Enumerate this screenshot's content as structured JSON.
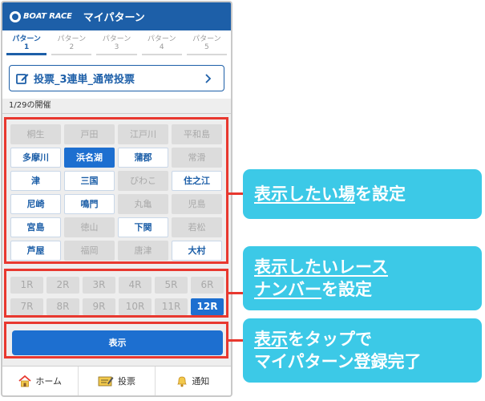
{
  "app": {
    "logo_text": "BOAT RACE",
    "title": "マイパターン"
  },
  "tabs": [
    {
      "label": "パターン",
      "num": "1",
      "active": true
    },
    {
      "label": "パターン",
      "num": "2",
      "active": false
    },
    {
      "label": "パターン",
      "num": "3",
      "active": false
    },
    {
      "label": "パターン",
      "num": "4",
      "active": false
    },
    {
      "label": "パターン",
      "num": "5",
      "active": false
    }
  ],
  "vote_button": {
    "label": "投票_3連単_通常投票"
  },
  "date_label": "1/29の開催",
  "venues": [
    {
      "name": "桐生",
      "state": "off"
    },
    {
      "name": "戸田",
      "state": "off"
    },
    {
      "name": "江戸川",
      "state": "off"
    },
    {
      "name": "平和島",
      "state": "off"
    },
    {
      "name": "多摩川",
      "state": "on"
    },
    {
      "name": "浜名湖",
      "state": "sel"
    },
    {
      "name": "蒲郡",
      "state": "on"
    },
    {
      "name": "常滑",
      "state": "off"
    },
    {
      "name": "津",
      "state": "on"
    },
    {
      "name": "三国",
      "state": "on"
    },
    {
      "name": "びわこ",
      "state": "off"
    },
    {
      "name": "住之江",
      "state": "on"
    },
    {
      "name": "尼崎",
      "state": "on"
    },
    {
      "name": "鳴門",
      "state": "on"
    },
    {
      "name": "丸亀",
      "state": "off"
    },
    {
      "name": "児島",
      "state": "off"
    },
    {
      "name": "宮島",
      "state": "on"
    },
    {
      "name": "徳山",
      "state": "off"
    },
    {
      "name": "下関",
      "state": "on"
    },
    {
      "name": "若松",
      "state": "off"
    },
    {
      "name": "芦屋",
      "state": "on"
    },
    {
      "name": "福岡",
      "state": "off"
    },
    {
      "name": "唐津",
      "state": "off"
    },
    {
      "name": "大村",
      "state": "on"
    }
  ],
  "races": [
    {
      "label": "1R",
      "state": "off"
    },
    {
      "label": "2R",
      "state": "off"
    },
    {
      "label": "3R",
      "state": "off"
    },
    {
      "label": "4R",
      "state": "off"
    },
    {
      "label": "5R",
      "state": "off"
    },
    {
      "label": "6R",
      "state": "off"
    },
    {
      "label": "7R",
      "state": "off"
    },
    {
      "label": "8R",
      "state": "off"
    },
    {
      "label": "9R",
      "state": "off"
    },
    {
      "label": "10R",
      "state": "off"
    },
    {
      "label": "11R",
      "state": "off"
    },
    {
      "label": "12R",
      "state": "sel"
    }
  ],
  "show_button": {
    "label": "表示"
  },
  "bottom_nav": [
    {
      "label": "ホーム",
      "icon": "home-icon"
    },
    {
      "label": "投票",
      "icon": "ticket-icon"
    },
    {
      "label": "通知",
      "icon": "bell-icon"
    }
  ],
  "callouts": {
    "venue": {
      "underlined": "表示したい場",
      "rest": "を設定"
    },
    "race": {
      "line1_underlined": "表示したいレース",
      "line2_underlined": "ナンバー",
      "line2_rest": "を設定"
    },
    "show": {
      "line1_underlined": "表示",
      "line1_rest": "をタップで",
      "line2": "マイパターン登録完了"
    }
  },
  "colors": {
    "brand_blue": "#1d5fa8",
    "selected_blue": "#1d6fd0",
    "highlight_red": "#e8382f",
    "callout_cyan": "#3cc9e7"
  }
}
